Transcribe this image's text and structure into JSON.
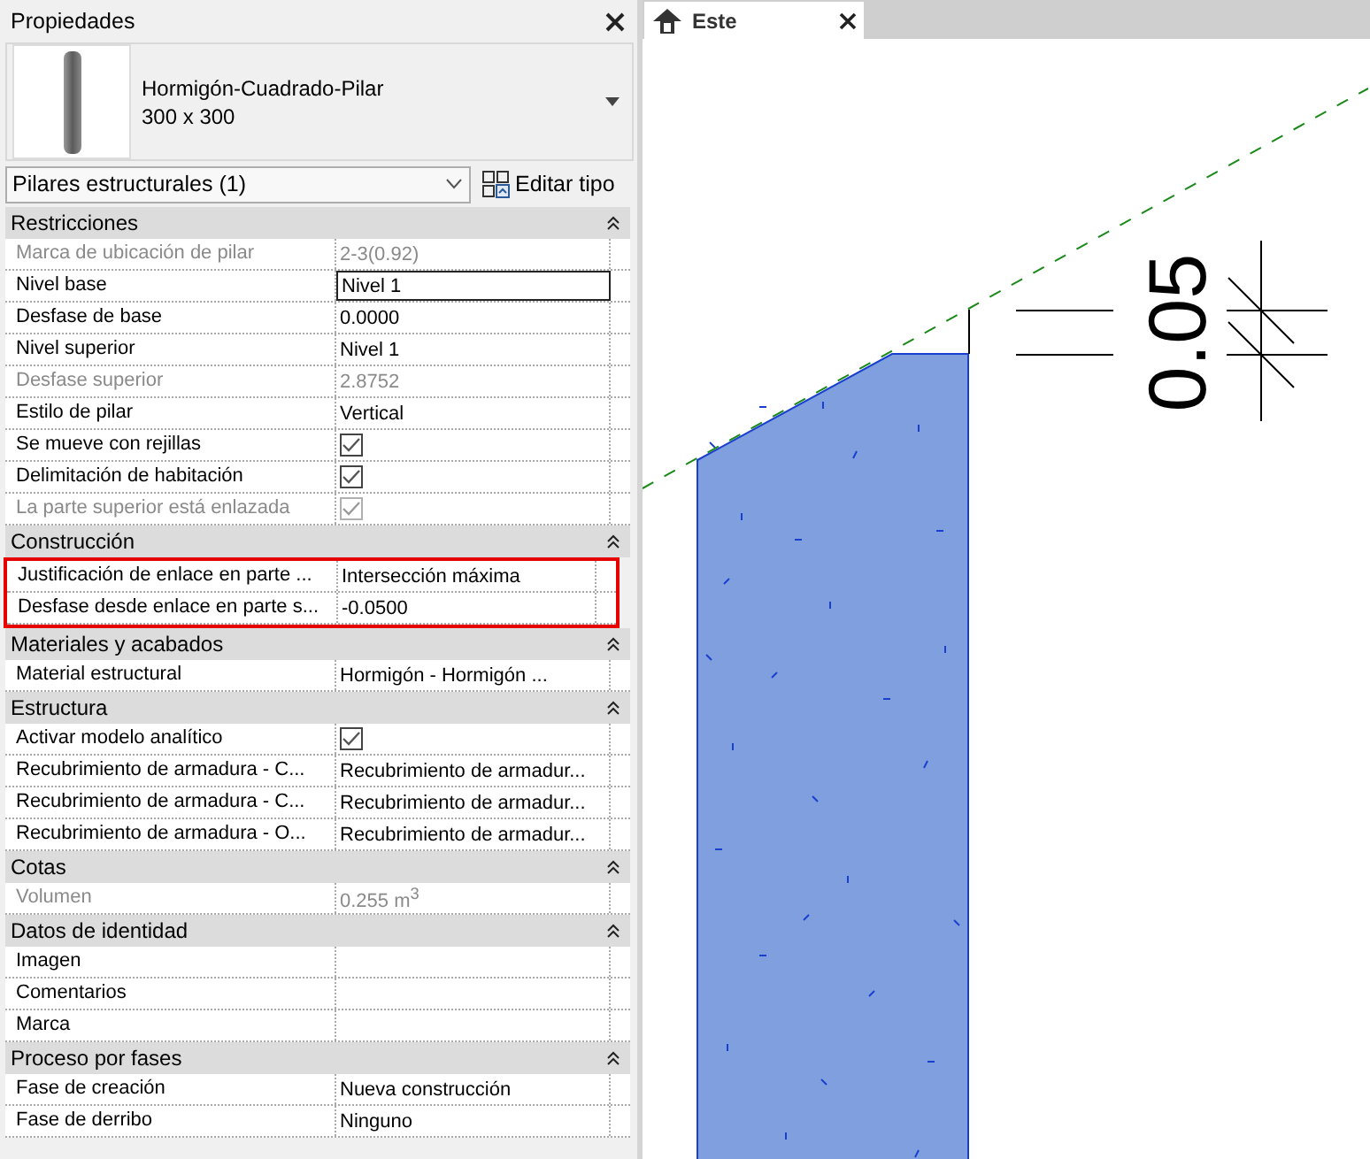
{
  "properties_panel": {
    "title": "Propiedades",
    "type_name": "Hormigón-Cuadrado-Pilar",
    "type_size": "300 x 300",
    "category_selector": "Pilares estructurales (1)",
    "edit_type_button": "Editar tipo",
    "sections": [
      {
        "title": "Restricciones",
        "expanded": true,
        "rows": [
          {
            "label": "Marca de ubicación de pilar",
            "kind": "text",
            "value": "2-3(0.92)",
            "disabled": true,
            "focused": false,
            "highlighted": false
          },
          {
            "label": "Nivel base",
            "kind": "text",
            "value": "Nivel 1",
            "disabled": false,
            "focused": true,
            "highlighted": false
          },
          {
            "label": "Desfase de base",
            "kind": "text",
            "value": "0.0000",
            "disabled": false,
            "focused": false,
            "highlighted": false
          },
          {
            "label": "Nivel superior",
            "kind": "text",
            "value": "Nivel 1",
            "disabled": false,
            "focused": false,
            "highlighted": false
          },
          {
            "label": "Desfase superior",
            "kind": "text",
            "value": "2.8752",
            "disabled": true,
            "focused": false,
            "highlighted": false
          },
          {
            "label": "Estilo de pilar",
            "kind": "text",
            "value": "Vertical",
            "disabled": false,
            "focused": false,
            "highlighted": false
          },
          {
            "label": "Se mueve con rejillas",
            "kind": "checkbox",
            "checked": true,
            "disabled": false,
            "focused": false,
            "highlighted": false
          },
          {
            "label": "Delimitación de habitación",
            "kind": "checkbox",
            "checked": true,
            "disabled": false,
            "focused": false,
            "highlighted": false
          },
          {
            "label": "La parte superior está enlazada",
            "kind": "checkbox",
            "checked": true,
            "disabled": true,
            "focused": false,
            "highlighted": false
          }
        ]
      },
      {
        "title": "Construcción",
        "expanded": true,
        "rows": [
          {
            "label": "Justificación de enlace en parte ...",
            "kind": "text",
            "value": "Intersección máxima",
            "disabled": false,
            "focused": false,
            "highlighted": true
          },
          {
            "label": "Desfase desde enlace en parte s...",
            "kind": "text",
            "value": "-0.0500",
            "disabled": false,
            "focused": false,
            "highlighted": true
          }
        ]
      },
      {
        "title": "Materiales y acabados",
        "expanded": true,
        "rows": [
          {
            "label": "Material estructural",
            "kind": "text",
            "value": "Hormigón - Hormigón ...",
            "disabled": false,
            "focused": false,
            "highlighted": false
          }
        ]
      },
      {
        "title": "Estructura",
        "expanded": true,
        "rows": [
          {
            "label": "Activar modelo analítico",
            "kind": "checkbox",
            "checked": true,
            "disabled": false,
            "focused": false,
            "highlighted": false
          },
          {
            "label": "Recubrimiento de armadura - C...",
            "kind": "text",
            "value": "Recubrimiento de armadur...",
            "disabled": false,
            "focused": false,
            "highlighted": false
          },
          {
            "label": "Recubrimiento de armadura - C...",
            "kind": "text",
            "value": "Recubrimiento de armadur...",
            "disabled": false,
            "focused": false,
            "highlighted": false
          },
          {
            "label": "Recubrimiento de armadura - O...",
            "kind": "text",
            "value": "Recubrimiento de armadur...",
            "disabled": false,
            "focused": false,
            "highlighted": false
          }
        ]
      },
      {
        "title": "Cotas",
        "expanded": true,
        "rows": [
          {
            "label": "Volumen",
            "kind": "text",
            "value": "0.255 m$^{3}$",
            "disabled": true,
            "focused": false,
            "highlighted": false
          }
        ]
      },
      {
        "title": "Datos de identidad",
        "expanded": true,
        "rows": [
          {
            "label": "Imagen",
            "kind": "text",
            "disabled": false,
            "focused": false,
            "highlighted": false
          },
          {
            "label": "Comentarios",
            "kind": "text",
            "disabled": false,
            "focused": false,
            "highlighted": false
          },
          {
            "label": "Marca",
            "kind": "text",
            "disabled": false,
            "focused": false,
            "highlighted": false
          }
        ]
      },
      {
        "title": "Proceso por fases",
        "expanded": true,
        "rows": [
          {
            "label": "Fase de creación",
            "kind": "text",
            "value": "Nueva construcción",
            "disabled": false,
            "focused": false,
            "highlighted": false
          },
          {
            "label": "Fase de derribo",
            "kind": "text",
            "value": "Ninguno",
            "disabled": false,
            "focused": false,
            "highlighted": false
          }
        ]
      }
    ]
  },
  "view": {
    "tab": {
      "label": "Este",
      "selected": true
    },
    "dimension": "0.05"
  }
}
